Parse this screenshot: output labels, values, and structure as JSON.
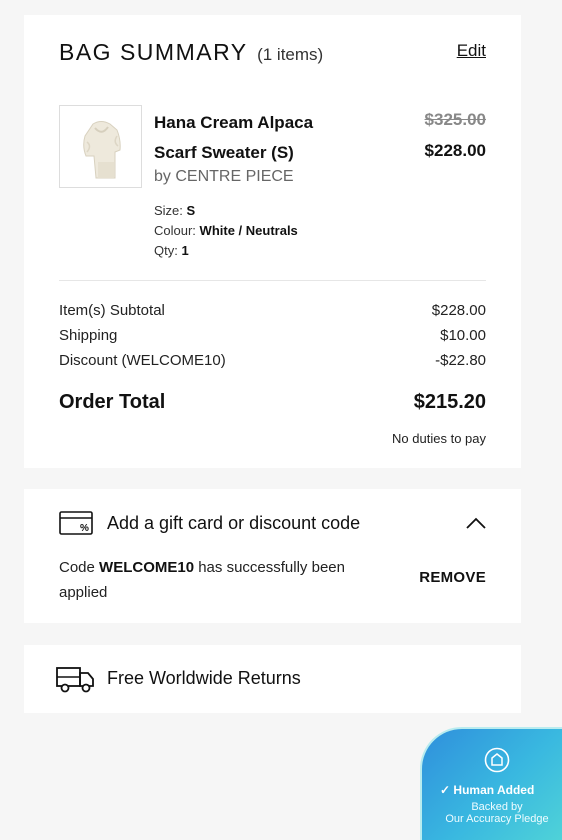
{
  "summary": {
    "title": "BAG SUMMARY",
    "item_count": "(1 items)",
    "edit_label": "Edit",
    "product": {
      "name": "Hana Cream Alpaca Scarf Sweater (S)",
      "brand": "by CENTRE PIECE",
      "price_original": "$325.00",
      "price_sale": "$228.00",
      "size_label": "Size:",
      "size_value": "S",
      "colour_label": "Colour:",
      "colour_value": "White / Neutrals",
      "qty_label": "Qty:",
      "qty_value": "1"
    },
    "rows": [
      {
        "label": "Item(s) Subtotal",
        "value": "$228.00"
      },
      {
        "label": "Shipping",
        "value": "$10.00"
      },
      {
        "label": "Discount (WELCOME10)",
        "value": "-$22.80"
      }
    ],
    "total_label": "Order Total",
    "total_value": "$215.20",
    "duties_note": "No duties to pay"
  },
  "giftcard": {
    "label": "Add a gift card or discount code",
    "msg_prefix": "Code",
    "code": "WELCOME10",
    "msg_suffix": "has successfully been applied",
    "remove_label": "REMOVE"
  },
  "returns": {
    "label": "Free Worldwide Returns"
  },
  "badge": {
    "title": "Human Added",
    "line1": "Backed by",
    "line2": "Our Accuracy Pledge"
  }
}
